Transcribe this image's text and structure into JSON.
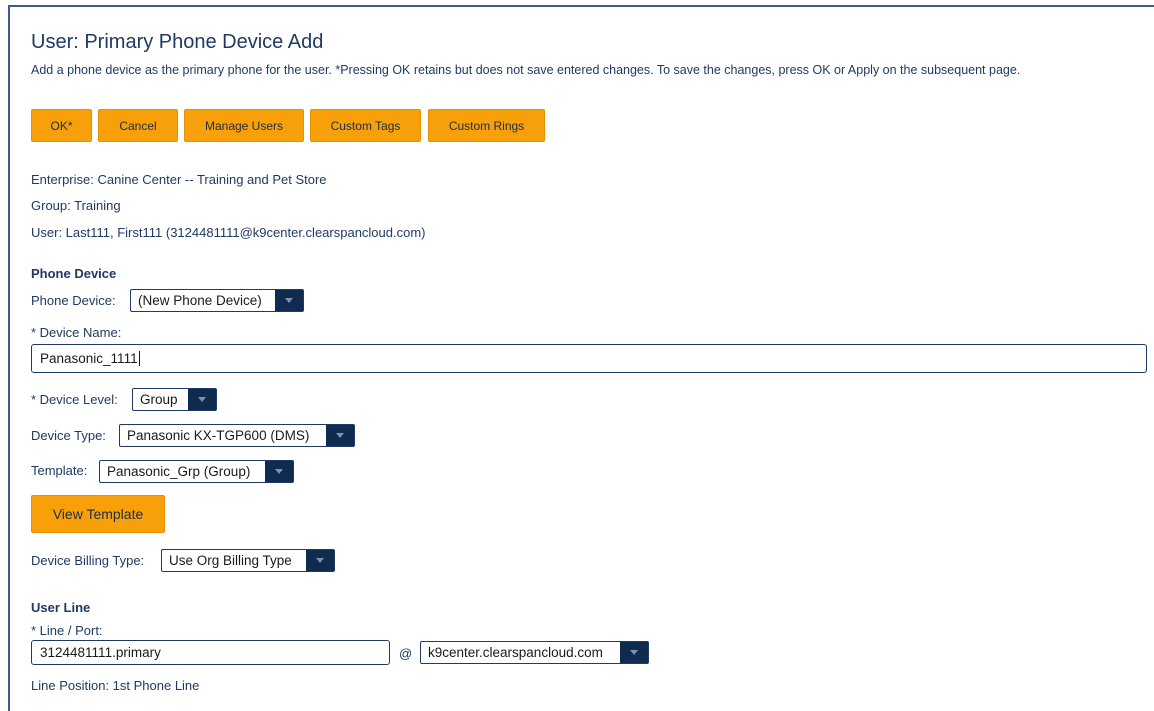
{
  "page": {
    "title": "User: Primary Phone Device Add",
    "description": "Add a phone device as the primary phone for the user. *Pressing OK retains but does not save entered changes. To save the changes, press OK or Apply on the subsequent page."
  },
  "buttons": {
    "ok": "OK*",
    "cancel": "Cancel",
    "manage_users": "Manage Users",
    "custom_tags": "Custom Tags",
    "custom_rings": "Custom Rings"
  },
  "context": {
    "enterprise": "Enterprise:  Canine Center -- Training and Pet Store",
    "group": "Group:  Training",
    "user": "User:  Last111, First111 (3124481111@k9center.clearspancloud.com)"
  },
  "phone_device": {
    "heading": "Phone Device",
    "device_label": "Phone Device:",
    "device_value": "(New Phone Device)",
    "name_label": "* Device Name:",
    "name_value": "Panasonic_1111",
    "level_label": "* Device Level:",
    "level_value": "Group",
    "type_label": "Device Type:",
    "type_value": "Panasonic KX-TGP600 (DMS)",
    "template_label": "Template:",
    "template_value": "Panasonic_Grp (Group)",
    "view_template_button": "View Template",
    "billing_label": "Device Billing Type:",
    "billing_value": "Use Org Billing Type"
  },
  "user_line": {
    "heading": "User Line",
    "line_port_label": "* Line / Port:",
    "line_port_value": "3124481111.primary",
    "at_sign": "@",
    "domain_value": "k9center.clearspancloud.com",
    "position_text": "Line Position:  1st Phone Line"
  },
  "icons": {
    "dropdown_arrow": "chevron-down-icon"
  },
  "colors": {
    "button_orange": "#f7a00a",
    "select_arrow_bg": "#0f2b50",
    "text_navy": "#1f3a63",
    "frame_border": "#3c5a8a"
  }
}
